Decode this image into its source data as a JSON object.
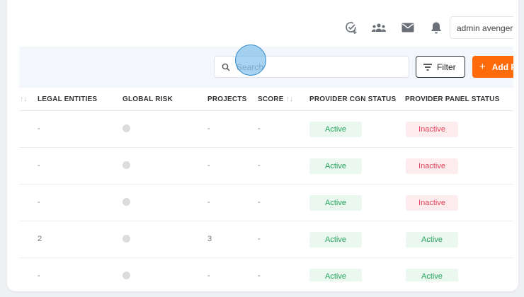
{
  "header": {
    "icons": [
      "check-plus-icon",
      "team-icon",
      "mail-icon",
      "bell-icon"
    ],
    "user_name": "admin avenger"
  },
  "toolbar": {
    "search_placeholder": "Search",
    "filter_label": "Filter",
    "add_label": "Add Provider"
  },
  "table": {
    "columns": {
      "legal_entities": "LEGAL ENTITIES",
      "global_risk": "GLOBAL RISK",
      "projects": "PROJECTS",
      "score": "SCORE",
      "cgn_status": "PROVIDER CGN STATUS",
      "panel_status": "PROVIDER PANEL STATUS"
    },
    "sort_glyph": "↑↓",
    "rows": [
      {
        "legal_entities": "-",
        "projects": "-",
        "score": "-",
        "cgn_status": "Active",
        "panel_status": "Inactive"
      },
      {
        "legal_entities": "-",
        "projects": "-",
        "score": "-",
        "cgn_status": "Active",
        "panel_status": "Inactive"
      },
      {
        "legal_entities": "-",
        "projects": "-",
        "score": "-",
        "cgn_status": "Active",
        "panel_status": "Inactive"
      },
      {
        "legal_entities": "2",
        "projects": "3",
        "score": "-",
        "cgn_status": "Active",
        "panel_status": "Active"
      },
      {
        "legal_entities": "-",
        "projects": "-",
        "score": "-",
        "cgn_status": "Active",
        "panel_status": "Active"
      }
    ]
  },
  "colors": {
    "accent": "#ff6b0a",
    "active_text": "#25a35a",
    "active_bg": "#eaf8f0",
    "inactive_text": "#e0435a",
    "inactive_bg": "#fdecee"
  }
}
